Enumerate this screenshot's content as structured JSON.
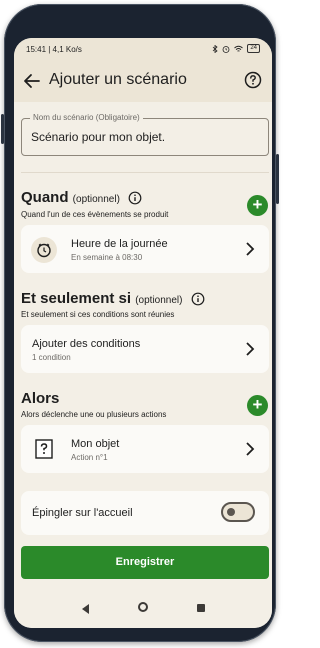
{
  "status_bar": {
    "time_speed": "15:41 | 4,1 Ko/s",
    "battery": "24"
  },
  "app_bar": {
    "back_icon": "arrow-left-icon",
    "title": "Ajouter un scénario",
    "help_icon": "question-circle-icon"
  },
  "name_field": {
    "label": "Nom du scénario (Obligatoire)",
    "value": "Scénario pour mon objet."
  },
  "quand": {
    "title": "Quand",
    "optional": "(optionnel)",
    "subtitle": "Quand l'un de ces évènements se produit",
    "card": {
      "icon": "clock-icon",
      "title": "Heure de la journée",
      "subtitle": "En semaine à 08:30"
    }
  },
  "seulement": {
    "title": "Et seulement si",
    "optional": "(optionnel)",
    "subtitle": "Et seulement si ces conditions sont réunies",
    "card": {
      "title": "Ajouter des conditions",
      "subtitle": "1 condition"
    }
  },
  "alors": {
    "title": "Alors",
    "subtitle": "Alors déclenche une ou plusieurs actions",
    "card": {
      "icon": "unknown-object-icon",
      "title": "Mon objet",
      "subtitle": "Action n°1"
    }
  },
  "pin": {
    "label": "Épingler sur l'accueil",
    "enabled": false
  },
  "save_button": "Enregistrer",
  "colors": {
    "accent_green": "#2b8a2a",
    "background": "#f3efe6",
    "header": "#ece5d6",
    "card": "#fbfaf7"
  }
}
